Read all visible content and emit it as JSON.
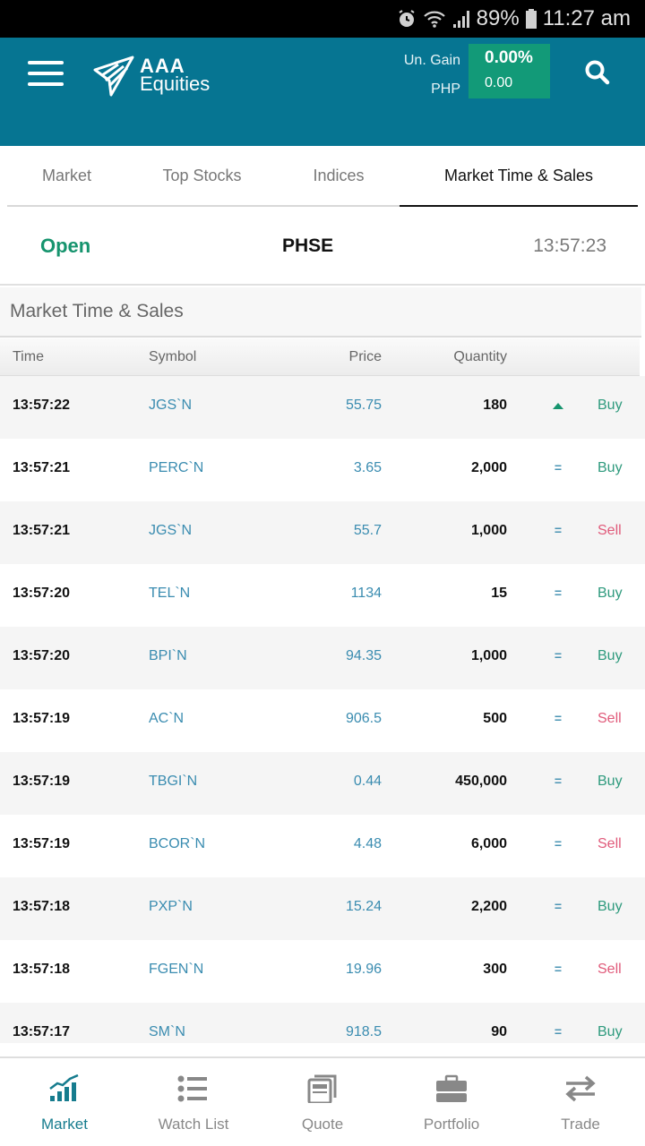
{
  "status_bar": {
    "battery": "89%",
    "time": "11:27 am",
    "icons": [
      "alarm-icon",
      "wifi-icon",
      "signal-icon",
      "battery-icon"
    ]
  },
  "app_bar": {
    "logo": {
      "line1": "AAA",
      "line2": "Equities"
    },
    "unrealized_gain_label": "Un. Gain",
    "currency_label": "PHP",
    "gain_percent": "0.00%",
    "gain_value": "0.00",
    "colors": {
      "bar": "#067592",
      "gain_box": "#129a78"
    }
  },
  "tabs": [
    {
      "label": "Market",
      "active": false
    },
    {
      "label": "Top Stocks",
      "active": false
    },
    {
      "label": "Indices",
      "active": false
    },
    {
      "label": "Market Time & Sales",
      "active": true
    }
  ],
  "market_status": {
    "state": "Open",
    "exchange": "PHSE",
    "time": "13:57:23"
  },
  "section_title": "Market Time & Sales",
  "table": {
    "columns": [
      "Time",
      "Symbol",
      "Price",
      "Quantity"
    ],
    "rows": [
      {
        "time": "13:57:22",
        "symbol": "JGS`N",
        "price": "55.75",
        "quantity": "180",
        "indicator": "up",
        "side": "Buy"
      },
      {
        "time": "13:57:21",
        "symbol": "PERC`N",
        "price": "3.65",
        "quantity": "2,000",
        "indicator": "=",
        "side": "Buy"
      },
      {
        "time": "13:57:21",
        "symbol": "JGS`N",
        "price": "55.7",
        "quantity": "1,000",
        "indicator": "=",
        "side": "Sell"
      },
      {
        "time": "13:57:20",
        "symbol": "TEL`N",
        "price": "1134",
        "quantity": "15",
        "indicator": "=",
        "side": "Buy"
      },
      {
        "time": "13:57:20",
        "symbol": "BPI`N",
        "price": "94.35",
        "quantity": "1,000",
        "indicator": "=",
        "side": "Buy"
      },
      {
        "time": "13:57:19",
        "symbol": "AC`N",
        "price": "906.5",
        "quantity": "500",
        "indicator": "=",
        "side": "Sell"
      },
      {
        "time": "13:57:19",
        "symbol": "TBGI`N",
        "price": "0.44",
        "quantity": "450,000",
        "indicator": "=",
        "side": "Buy"
      },
      {
        "time": "13:57:19",
        "symbol": "BCOR`N",
        "price": "4.48",
        "quantity": "6,000",
        "indicator": "=",
        "side": "Sell"
      },
      {
        "time": "13:57:18",
        "symbol": "PXP`N",
        "price": "15.24",
        "quantity": "2,200",
        "indicator": "=",
        "side": "Buy"
      },
      {
        "time": "13:57:18",
        "symbol": "FGEN`N",
        "price": "19.96",
        "quantity": "300",
        "indicator": "=",
        "side": "Sell"
      },
      {
        "time": "13:57:17",
        "symbol": "SM`N",
        "price": "918.5",
        "quantity": "90",
        "indicator": "=",
        "side": "Buy"
      }
    ]
  },
  "bottom_nav": [
    {
      "label": "Market",
      "icon": "market-chart-icon",
      "active": true
    },
    {
      "label": "Watch List",
      "icon": "list-icon",
      "active": false
    },
    {
      "label": "Quote",
      "icon": "quote-icon",
      "active": false
    },
    {
      "label": "Portfolio",
      "icon": "briefcase-icon",
      "active": false
    },
    {
      "label": "Trade",
      "icon": "transfer-arrows-icon",
      "active": false
    }
  ]
}
